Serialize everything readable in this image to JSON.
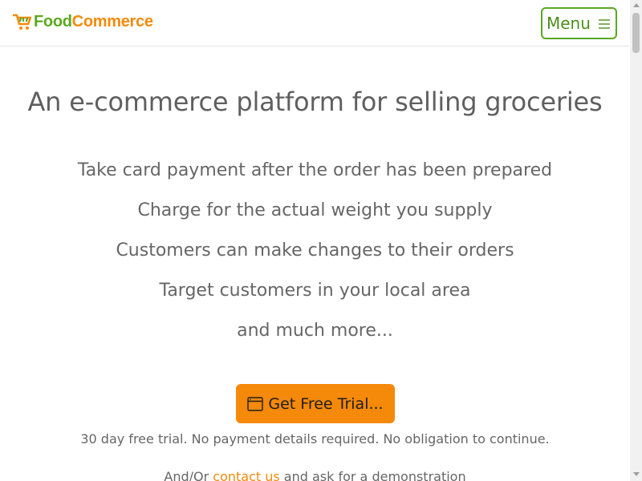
{
  "header": {
    "logo": {
      "text_part1": "Food",
      "text_part2": "Commerce",
      "icon": "shopping-cart-icon"
    },
    "menu_button": {
      "label": "Menu",
      "icon": "hamburger-icon"
    }
  },
  "hero": {
    "title": "An e-commerce platform for selling groceries",
    "features": [
      "Take card payment after the order has been prepared",
      "Charge for the actual weight you supply",
      "Customers can make changes to their orders",
      "Target customers in your local area",
      "and much more..."
    ]
  },
  "cta": {
    "label": "Get Free Trial...",
    "icon": "window-icon",
    "note": "30 day free trial. No payment details required. No obligation to continue."
  },
  "contact": {
    "prefix": "And/Or ",
    "link_text": "contact us",
    "suffix": " and ask for a demonstration"
  },
  "colors": {
    "brand_green": "#5aa820",
    "brand_orange": "#f58a0a",
    "cta_orange": "#f5890a",
    "text_gray": "#5f5f5f"
  }
}
